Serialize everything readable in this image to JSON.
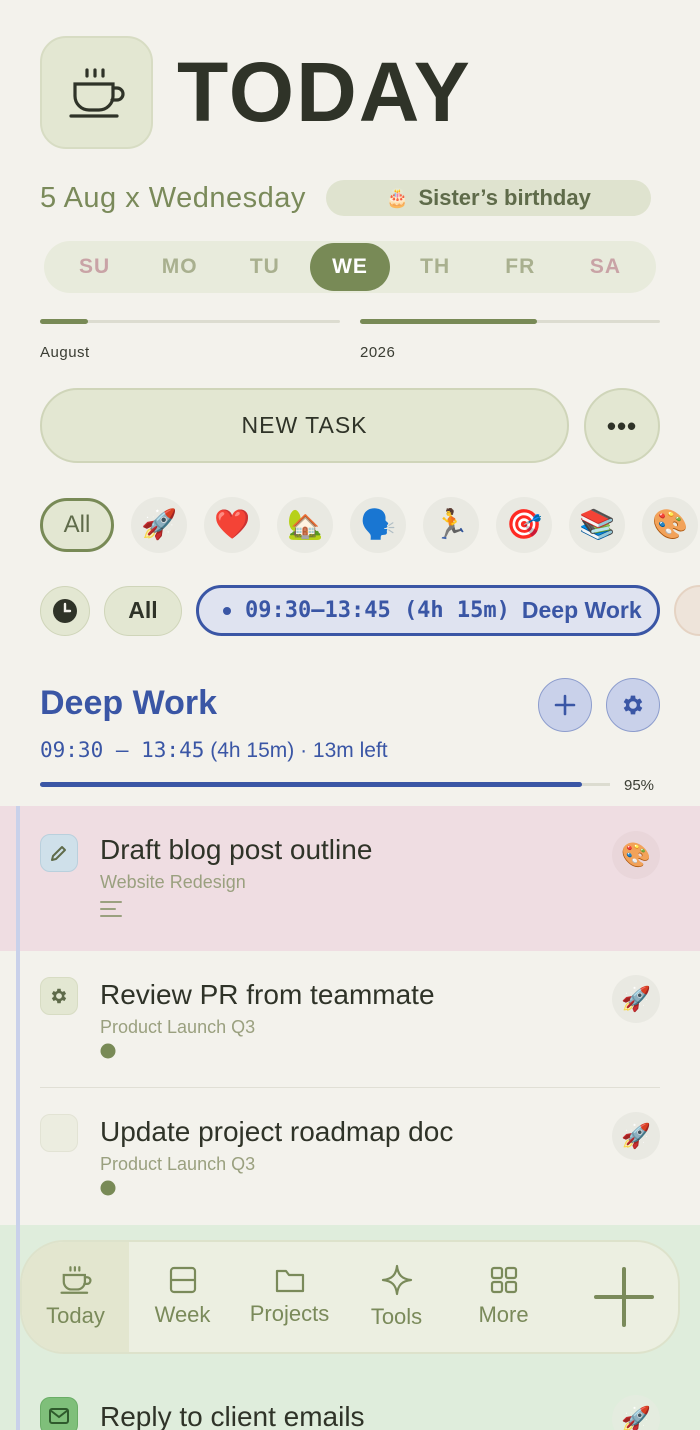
{
  "header": {
    "title": "TODAY",
    "icon": "coffee-cup-icon"
  },
  "date": {
    "text": "5 Aug x Wednesday",
    "event_label": "Sister’s birthday",
    "event_icon": "🎂"
  },
  "week": {
    "days": [
      "SU",
      "MO",
      "TU",
      "WE",
      "TH",
      "FR",
      "SA"
    ],
    "active_index": 3
  },
  "progress": {
    "month": {
      "label": "August",
      "value": 0.16
    },
    "year": {
      "label": "2026",
      "value": 0.59
    }
  },
  "actions": {
    "new_task_label": "NEW TASK",
    "more_label": "•••"
  },
  "categories": {
    "all_label": "All",
    "icons": [
      "🚀",
      "❤️",
      "🏡",
      "🗣️",
      "🏃",
      "🎯",
      "📚",
      "🎨"
    ]
  },
  "time_filter": {
    "all_label": "All",
    "block_time": "09:30–13:45 (4h 15m)",
    "block_name": "Deep Work"
  },
  "section": {
    "title": "Deep Work",
    "time_range": "09:30 — 13:45",
    "duration": "(4h 15m) · 13m left",
    "progress": 0.95,
    "progress_label": "95%"
  },
  "tasks": [
    {
      "title": "Draft blog post outline",
      "project": "Website Redesign",
      "category_icon": "🎨",
      "check_icon": "pencil-icon",
      "bg": "#efdde2"
    },
    {
      "title": "Review PR from teammate",
      "project": "Product Launch Q3",
      "category_icon": "🚀",
      "check_icon": "gear-icon",
      "bg": "#f3f2ec"
    },
    {
      "title": "Update project roadmap doc",
      "project": "Product Launch Q3",
      "category_icon": "🚀",
      "check_icon": "empty-checkbox",
      "bg": "#f3f2ec"
    },
    {
      "title": "Reply to client emails",
      "project": "",
      "category_icon": "🚀",
      "check_icon": "mail-icon",
      "bg": "#dfeddc"
    }
  ],
  "nav": {
    "items": [
      {
        "label": "Today",
        "icon": "coffee-cup-icon"
      },
      {
        "label": "Week",
        "icon": "week-icon"
      },
      {
        "label": "Projects",
        "icon": "folder-icon"
      },
      {
        "label": "Tools",
        "icon": "sparkle-icon"
      },
      {
        "label": "More",
        "icon": "grid-icon"
      }
    ],
    "add_icon": "plus-icon"
  },
  "colors": {
    "accent": "#788a56",
    "block": "#3a56a5",
    "background": "#f3f2ec"
  }
}
